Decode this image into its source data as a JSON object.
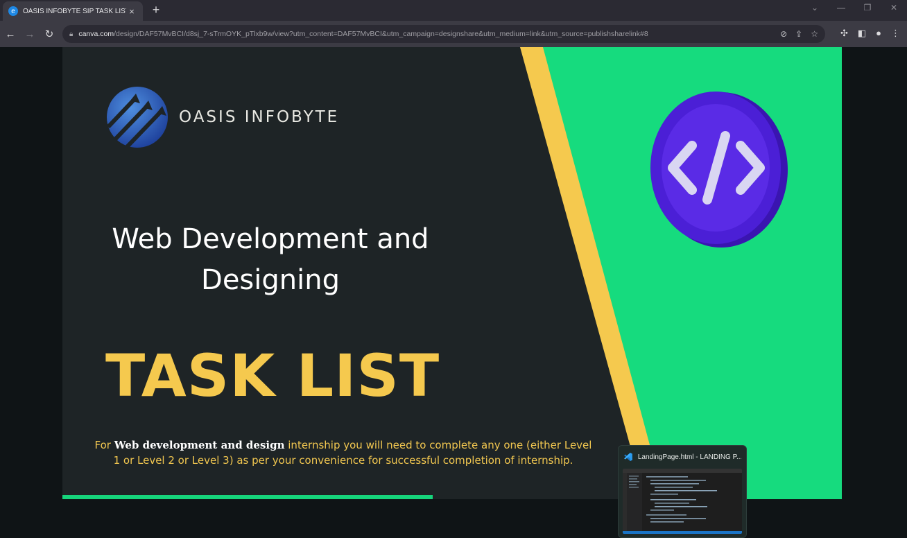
{
  "browser": {
    "tab_title": "OASIS INFOBYTE SIP TASK LIST",
    "tab_close": "×",
    "new_tab": "+",
    "url_host": "canva.com",
    "url_rest": "/design/DAF57MvBCI/d8sj_7-sTrmOYK_pTlxb9w/view?utm_content=DAF57MvBCI&utm_campaign=designshare&utm_medium=link&utm_source=publishsharelink#8"
  },
  "slide": {
    "logo_text": "OASIS INFOBYTE",
    "heading": "Web Development and Designing",
    "title": "TASK LIST",
    "desc_prefix": "For ",
    "desc_bold": "Web development and design",
    "desc_suffix": " internship you will need to complete any one (either Level 1 or Level 2 or Level 3) as per your convenience for successful completion of internship.",
    "progress_fraction": 0.475,
    "colors": {
      "green": "#16db7e",
      "yellow": "#f5c94e",
      "dark": "#1e2426",
      "coin": "#4b1fd6"
    }
  },
  "thumbnail": {
    "title": "LandingPage.html - LANDING P..."
  }
}
